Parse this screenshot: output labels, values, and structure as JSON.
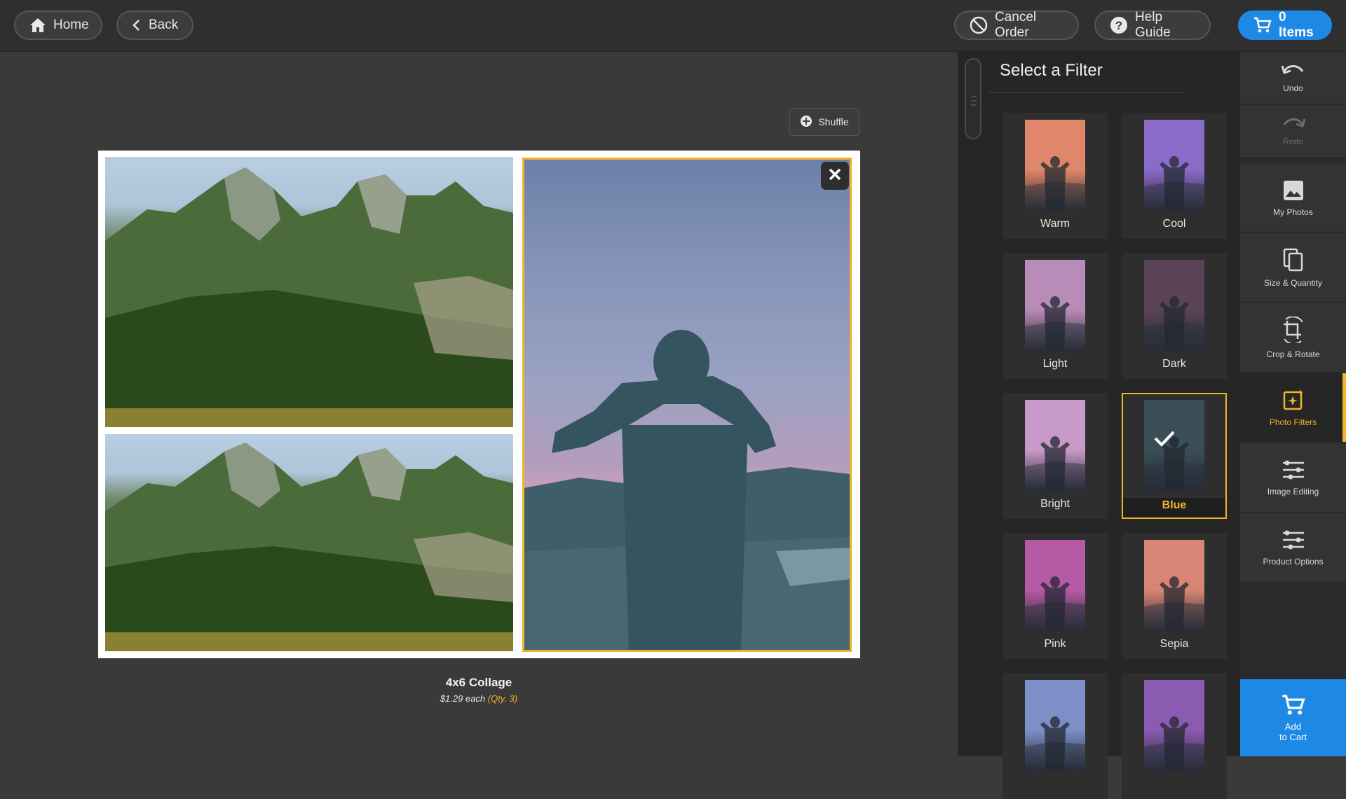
{
  "header": {
    "home_label": "Home",
    "back_label": "Back",
    "cancel_label": "Cancel Order",
    "help_label": "Help Guide",
    "cart_label": "0 Items"
  },
  "workspace": {
    "shuffle_label": "Shuffle",
    "product_title": "4x6 Collage",
    "price_each": "$1.29 each",
    "qty_label": "(Qty. 3)"
  },
  "filters": {
    "title": "Select a Filter",
    "selected": "Blue",
    "items": [
      {
        "label": "Warm",
        "tint": "#e0866a"
      },
      {
        "label": "Cool",
        "tint": "#8a6bc7"
      },
      {
        "label": "Light",
        "tint": "#b98bb8"
      },
      {
        "label": "Dark",
        "tint": "#5a4257"
      },
      {
        "label": "Bright",
        "tint": "#c79ac9"
      },
      {
        "label": "Blue",
        "tint": "#3a4e57"
      },
      {
        "label": "Pink",
        "tint": "#b65aa6"
      },
      {
        "label": "Sepia",
        "tint": "#d88576"
      },
      {
        "label": "",
        "tint": "#7c8fc6"
      },
      {
        "label": "",
        "tint": "#8a5bb0"
      }
    ]
  },
  "toolbar": {
    "undo": "Undo",
    "redo": "Redo",
    "my_photos": "My Photos",
    "size_quantity": "Size & Quantity",
    "crop_rotate": "Crop & Rotate",
    "photo_filters": "Photo Filters",
    "image_editing": "Image Editing",
    "product_options": "Product Options",
    "add_to_cart_line1": "Add",
    "add_to_cart_line2": "to Cart"
  },
  "colors": {
    "accent": "#f0b429",
    "cart_blue": "#1e88e5",
    "background": "#3a3a3a"
  },
  "icons": [
    "home-icon",
    "chevron-left-icon",
    "cancel-icon",
    "help-icon",
    "cart-icon",
    "plus-circle-icon",
    "close-icon",
    "warning-icon",
    "check-icon",
    "undo-icon",
    "redo-icon",
    "image-icon",
    "copy-icon",
    "crop-rotate-icon",
    "sparkle-icon",
    "sliders-icon"
  ]
}
